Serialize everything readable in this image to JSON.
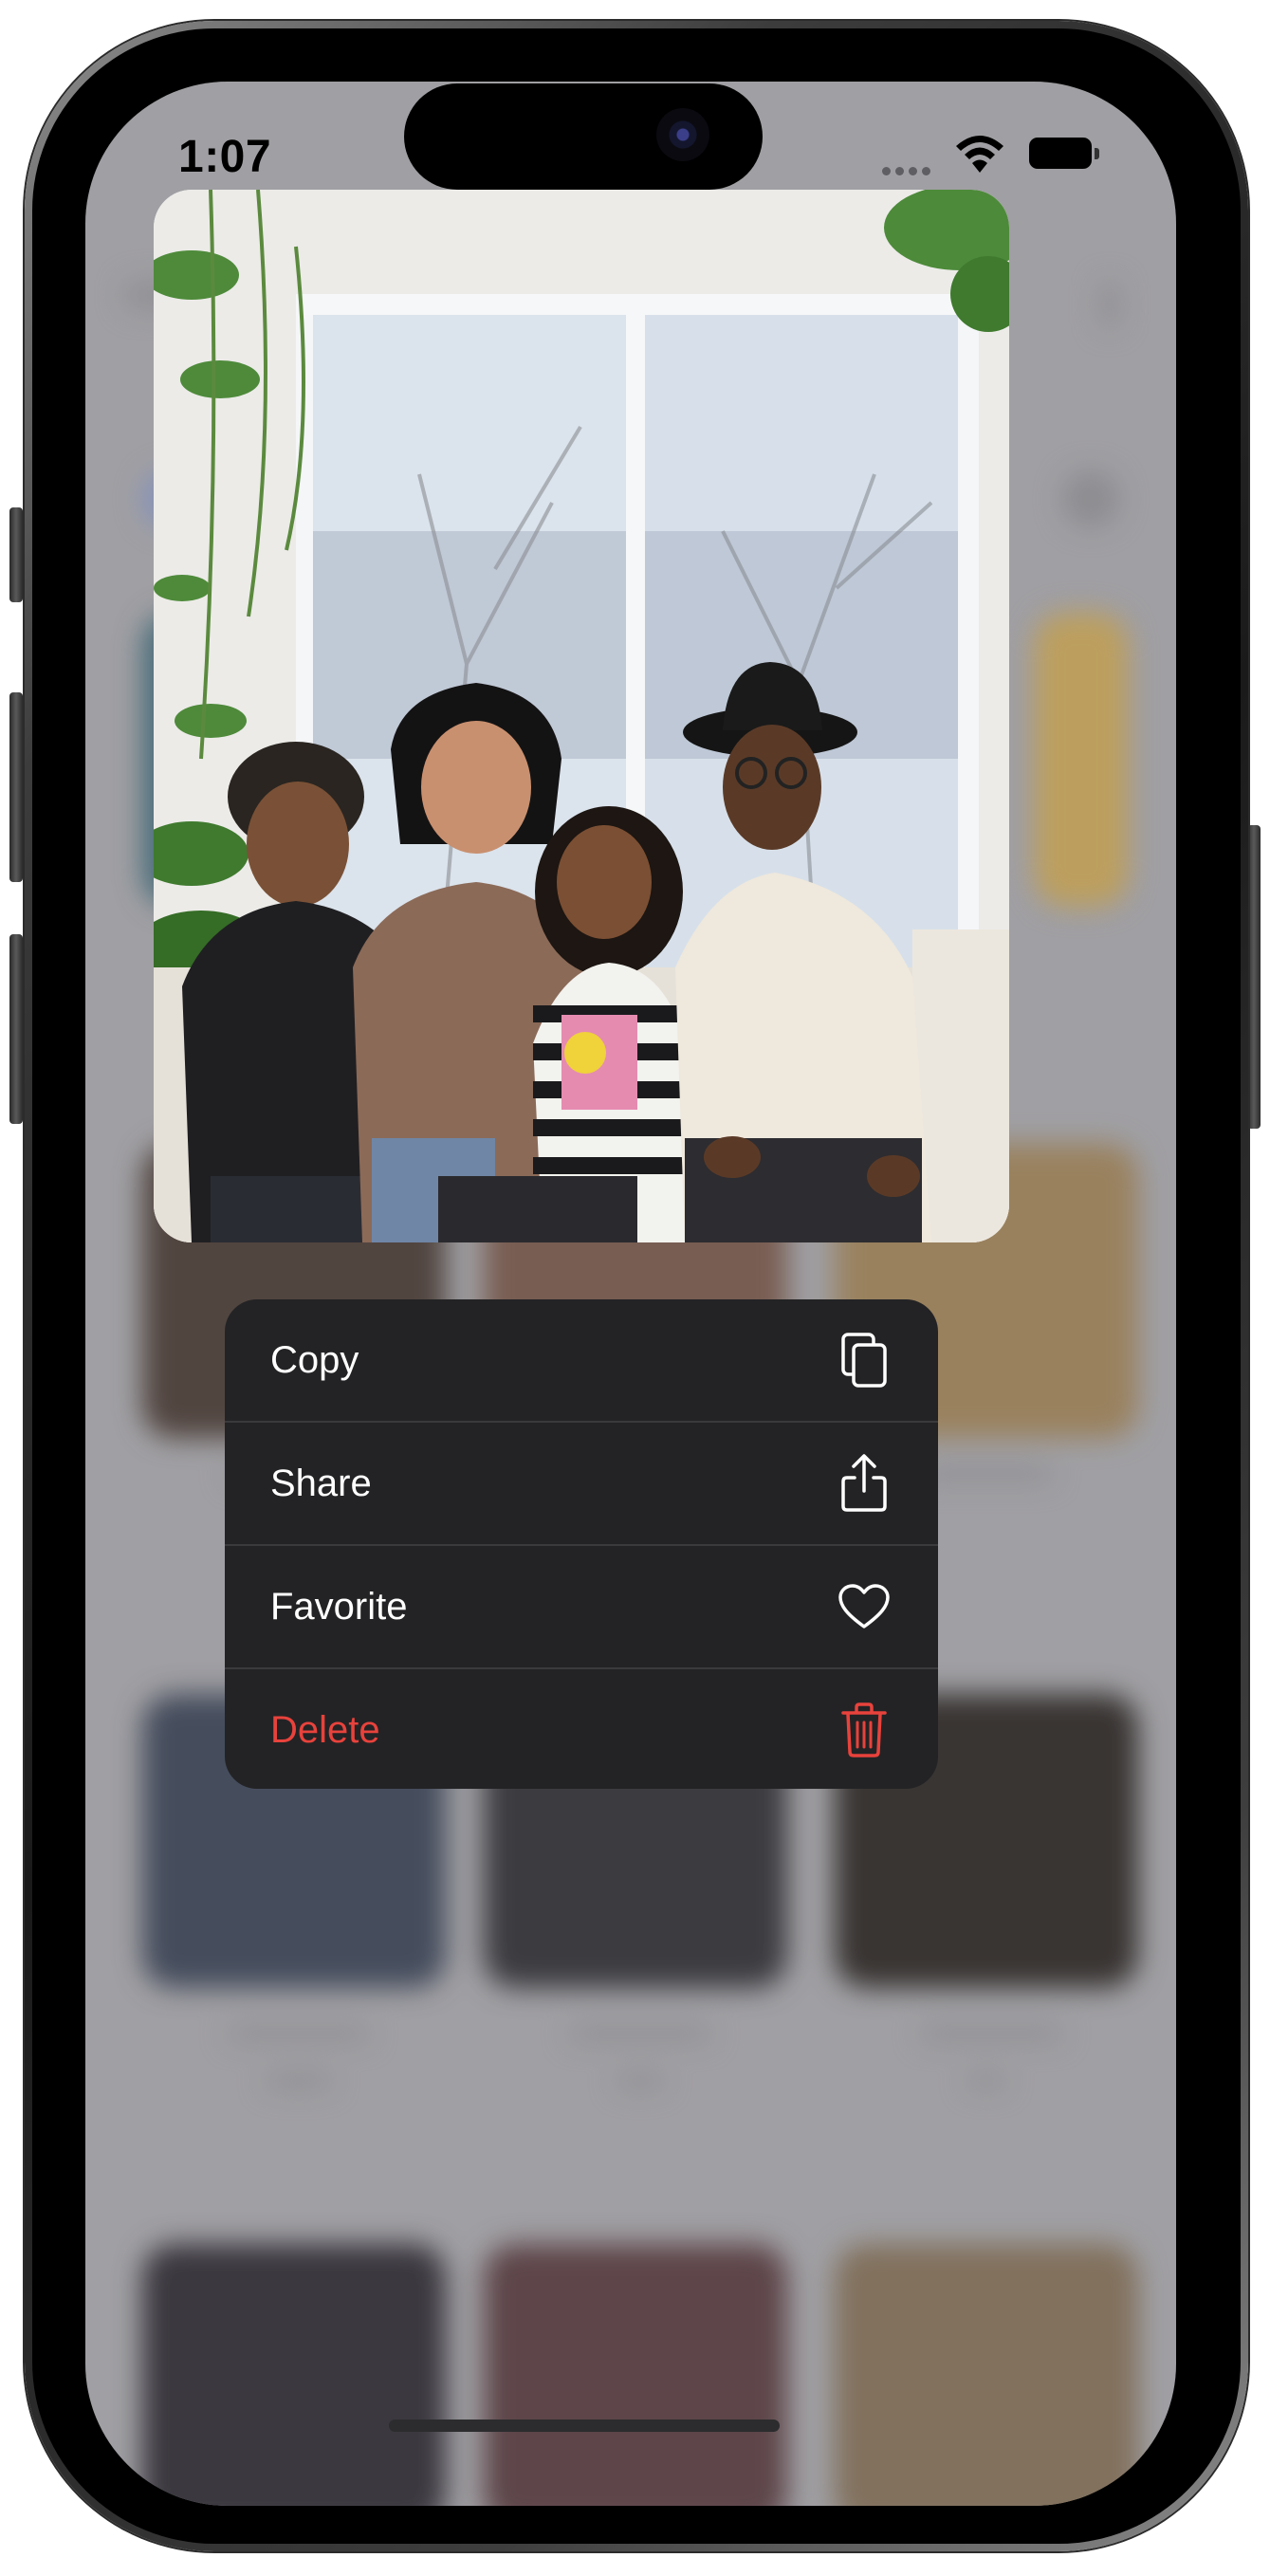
{
  "status_bar": {
    "time": "1:07"
  },
  "context_menu": {
    "items": [
      {
        "label": "Copy",
        "icon": "copy-icon",
        "destructive": false
      },
      {
        "label": "Share",
        "icon": "share-icon",
        "destructive": false
      },
      {
        "label": "Favorite",
        "icon": "heart-icon",
        "destructive": false
      },
      {
        "label": "Delete",
        "icon": "trash-icon",
        "destructive": true
      }
    ]
  },
  "colors": {
    "menu_background": "#232325",
    "menu_text": "#ffffff",
    "destructive": "#e8423c",
    "dimmed_background": "#a3a2a6"
  }
}
